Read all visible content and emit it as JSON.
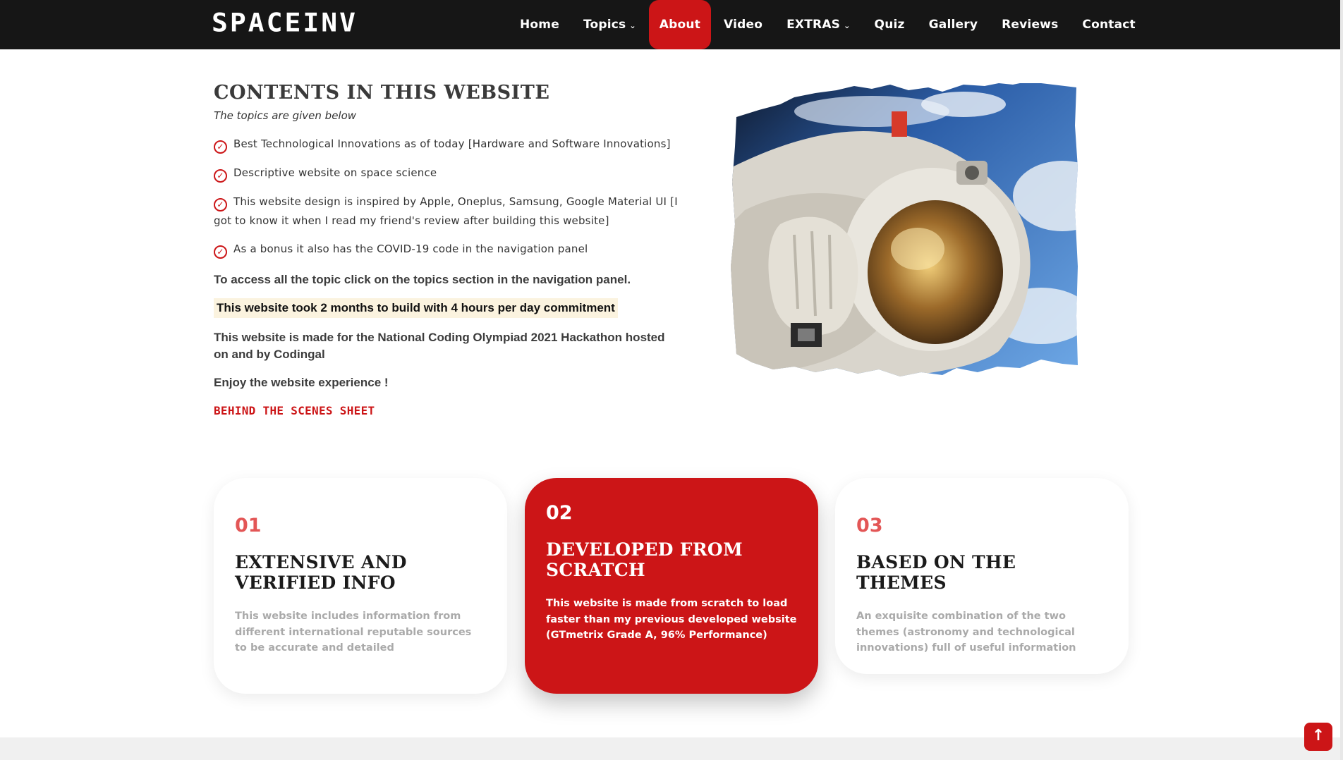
{
  "brand": {
    "logo": "SPACEINV"
  },
  "nav": {
    "items": [
      {
        "label": "Home"
      },
      {
        "label": "Topics",
        "chevron": "⌄"
      },
      {
        "label": "About"
      },
      {
        "label": "Video"
      },
      {
        "label": "EXTRAS",
        "chevron": "⌄"
      },
      {
        "label": "Quiz"
      },
      {
        "label": "Gallery"
      },
      {
        "label": "Reviews"
      },
      {
        "label": "Contact"
      }
    ],
    "active": "About"
  },
  "contents": {
    "title": "Contents in this website",
    "subtitle": "The topics are given below",
    "topics": [
      {
        "text": "Best Technological Innovations as of today [Hardware and Software Innovations]"
      },
      {
        "text": "Descriptive website on space science"
      },
      {
        "text": "This website design is inspired by Apple, Oneplus, Samsung, Google Material UI [I got to know it when I read my friend's review after building this website]"
      },
      {
        "text": "As a bonus it also has the COVID-19 code in the navigation panel"
      }
    ],
    "access_text": "To access all the topic click on the topics section in the navigation panel.",
    "build_time_text": "This website took 2 months to build with 4 hours per day commitment",
    "hackathon_text": "This website is made for the National Coding Olympiad 2021 Hackathon hosted on and by Codingal",
    "enjoy_text": "Enjoy the website experience !",
    "behind_link": "Behind the scenes sheet"
  },
  "cards": [
    {
      "num": "01",
      "title": "Extensive and verified info",
      "text": "This website includes information from different international reputable sources to be accurate and detailed"
    },
    {
      "num": "02",
      "title": "Developed from scratch",
      "text": "This website is made from scratch to load faster than my previous developed website (GTmetrix Grade A, 96% Performance)"
    },
    {
      "num": "03",
      "title": "Based on the themes",
      "text": "An exquisite combination of the two themes (astronomy and technological innovations) full of useful information"
    }
  ],
  "back_to_top": {
    "icon": "arrow-up-icon",
    "glyph": "↑"
  },
  "colors": {
    "accent": "#cc1517",
    "nav_bg": "#161616",
    "highlight_bg": "#fbf3df"
  }
}
